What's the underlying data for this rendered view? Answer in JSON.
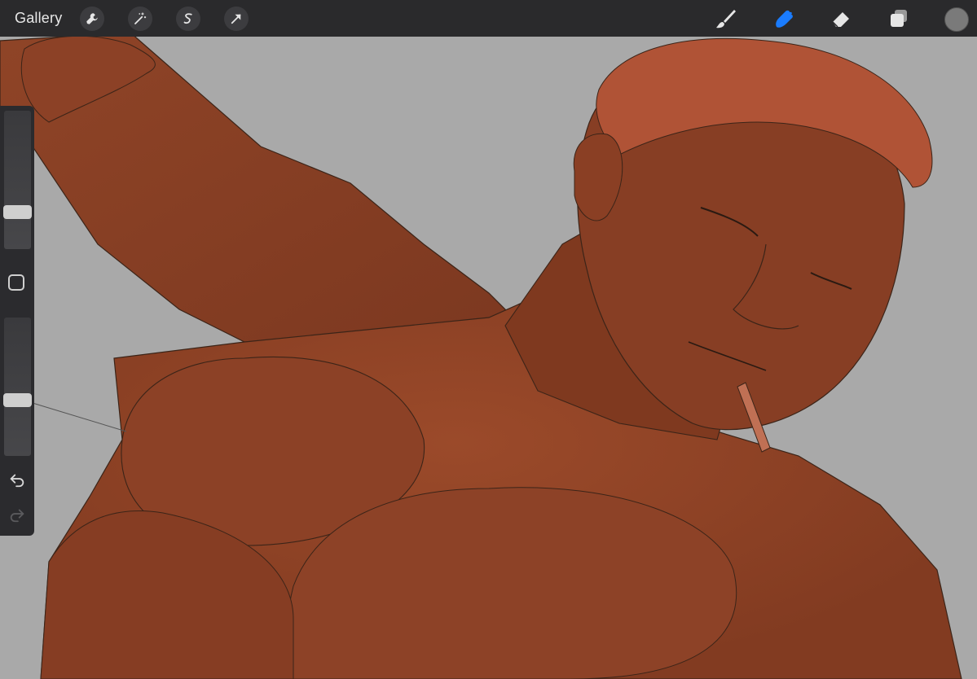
{
  "toolbar": {
    "gallery_label": "Gallery",
    "left_tools": [
      {
        "name": "actions",
        "icon": "wrench-icon"
      },
      {
        "name": "adjustments",
        "icon": "magic-wand-icon"
      },
      {
        "name": "selection",
        "icon": "selection-s-icon"
      },
      {
        "name": "transform",
        "icon": "arrow-cursor-icon"
      }
    ],
    "right_tools": [
      {
        "name": "paint",
        "icon": "brush-icon",
        "active": false
      },
      {
        "name": "smudge",
        "icon": "smudge-finger-icon",
        "active": true
      },
      {
        "name": "erase",
        "icon": "eraser-icon",
        "active": false
      },
      {
        "name": "layers",
        "icon": "layers-icon",
        "active": false
      }
    ],
    "active_color": "#7a7a7a",
    "accent_color": "#1a7cff"
  },
  "sidebar": {
    "brush_size": 0.3,
    "brush_opacity": 0.42,
    "controls": [
      "modify-icon",
      "undo-icon",
      "redo-icon"
    ]
  },
  "canvas": {
    "background": "#a9a9a9",
    "skin_color": "#8a3f24",
    "hair_color": "#b7583a"
  }
}
